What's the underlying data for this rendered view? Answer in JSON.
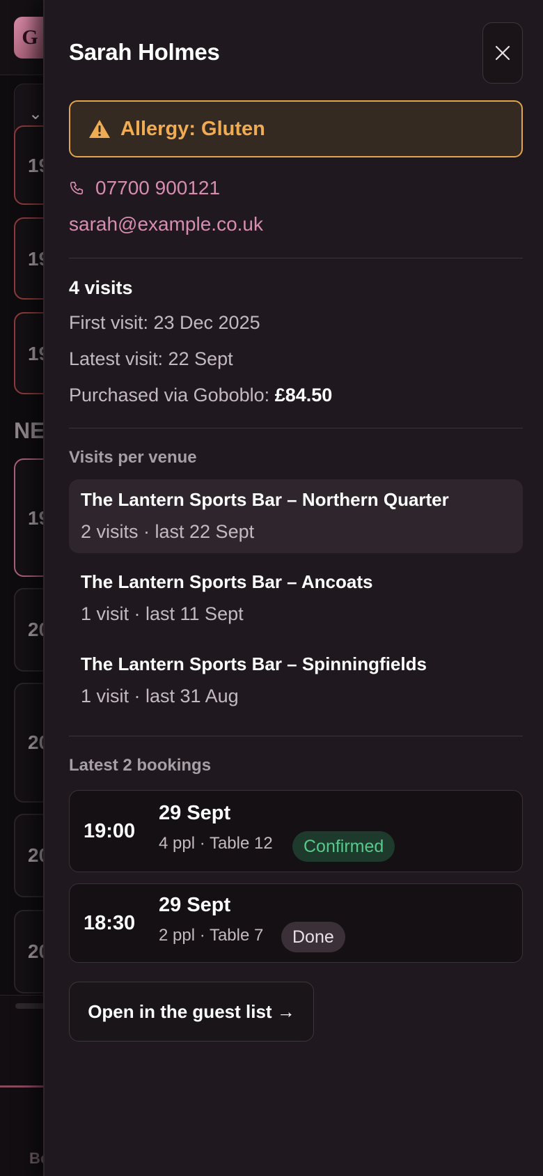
{
  "background": {
    "logo_letter": "G",
    "section_label": "NE",
    "card_times": [
      "19",
      "19",
      "19",
      "19",
      "20",
      "20",
      "20",
      "20"
    ],
    "bottom_tab": "Bo"
  },
  "drawer": {
    "guest_name": "Sarah Holmes",
    "close_icon": "close-icon",
    "allergy_label": "Allergy: Gluten",
    "phone": "07700 900121",
    "email": "sarah@example.co.uk",
    "visits_count": "4 visits",
    "first_visit": "First visit: 23 Dec 2025",
    "latest_visit": "Latest visit: 22 Sept",
    "purchased_prefix": "Purchased via Goboblo: ",
    "purchased_amount": "£84.50",
    "venues_heading": "Visits per venue",
    "venues": [
      {
        "name": "The Lantern Sports Bar – Northern Quarter",
        "summary": "2 visits · last 22 Sept"
      },
      {
        "name": "The Lantern Sports Bar – Ancoats",
        "summary": "1 visit · last 11 Sept"
      },
      {
        "name": "The Lantern Sports Bar – Spinningfields",
        "summary": "1 visit · last 31 Aug"
      }
    ],
    "bookings_heading": "Latest 2 bookings",
    "bookings": [
      {
        "time": "19:00",
        "date": "29 Sept",
        "details": "4 ppl · Table 12",
        "status": "Confirmed"
      },
      {
        "time": "18:30",
        "date": "29 Sept",
        "details": "2 ppl · Table 7",
        "status": "Done"
      }
    ],
    "open_button": "Open in the guest list →"
  },
  "colors": {
    "accent_pink": "#d78db1",
    "warning": "#f0ac52",
    "confirmed": "#57c98a"
  }
}
